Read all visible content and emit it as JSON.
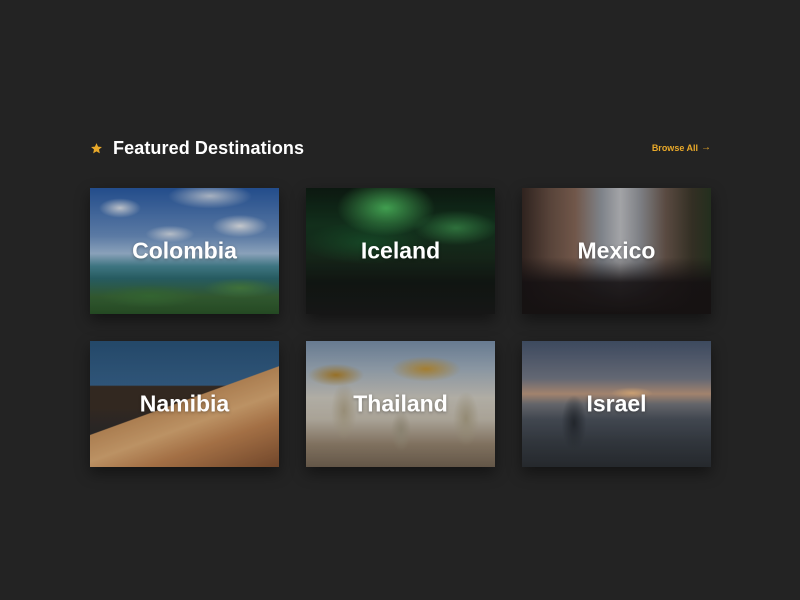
{
  "section": {
    "icon": "star-icon",
    "title": "Featured Destinations",
    "browse_label": "Browse All",
    "browse_icon": "arrow-right-icon",
    "accent_color": "#e9a92a"
  },
  "destinations": [
    {
      "name": "Colombia"
    },
    {
      "name": "Iceland"
    },
    {
      "name": "Mexico"
    },
    {
      "name": "Namibia"
    },
    {
      "name": "Thailand"
    },
    {
      "name": "Israel"
    }
  ]
}
